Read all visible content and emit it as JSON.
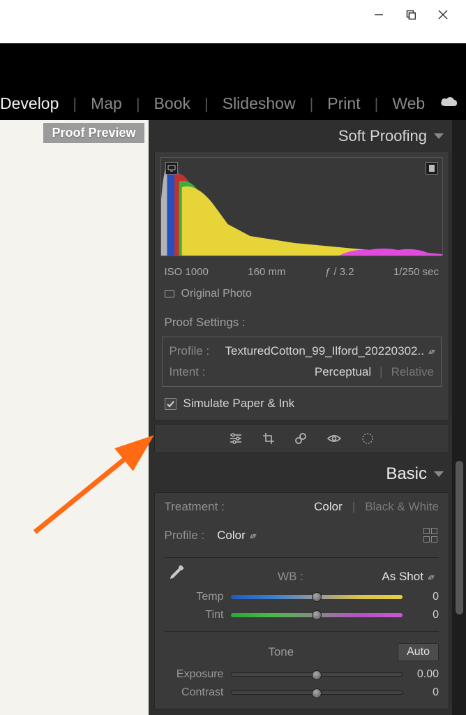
{
  "modules": {
    "develop": "Develop",
    "map": "Map",
    "book": "Book",
    "slideshow": "Slideshow",
    "print": "Print",
    "web": "Web"
  },
  "left": {
    "proof_preview": "Proof Preview"
  },
  "soft": {
    "title": "Soft Proofing",
    "meta": {
      "iso": "ISO 1000",
      "focal": "160 mm",
      "aperture": "ƒ / 3.2",
      "shutter": "1/250 sec"
    },
    "original": "Original Photo",
    "proof_settings": "Proof Settings :",
    "profile_label": "Profile :",
    "profile_value": "TexturedCotton_99_Ilford_20220302..",
    "intent_label": "Intent :",
    "intent_perceptual": "Perceptual",
    "intent_relative": "Relative",
    "simulate": "Simulate Paper & Ink"
  },
  "basic": {
    "title": "Basic",
    "treatment_label": "Treatment :",
    "color": "Color",
    "bw": "Black & White",
    "profile_label": "Profile :",
    "profile_value": "Color",
    "wb_label": "WB :",
    "wb_value": "As Shot",
    "temp": "Temp",
    "temp_val": "0",
    "tint": "Tint",
    "tint_val": "0",
    "tone": "Tone",
    "auto": "Auto",
    "exposure": "Exposure",
    "exposure_val": "0.00",
    "contrast": "Contrast",
    "contrast_val": "0"
  }
}
